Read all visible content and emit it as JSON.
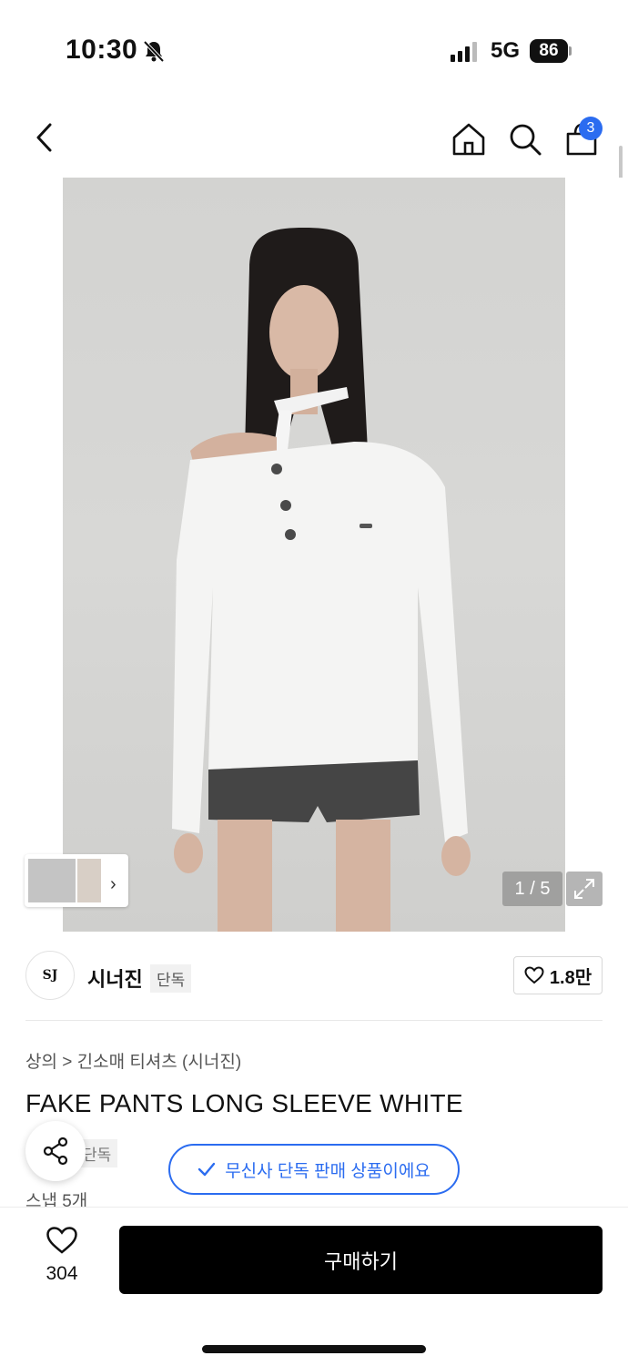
{
  "status_bar": {
    "time": "10:30",
    "network": "5G",
    "battery": "86",
    "icons": [
      "bell-slash-icon",
      "signal-icon"
    ]
  },
  "nav": {
    "cart_count": "3",
    "icons": [
      "back-icon",
      "home-icon",
      "search-icon",
      "cart-icon"
    ]
  },
  "gallery": {
    "counter": "1 / 5",
    "thumb_next": "›",
    "image_description_icon": "product-photo"
  },
  "brand": {
    "logo_text": "SJ",
    "name": "시너진",
    "tag": "단독",
    "likes": "1.8만"
  },
  "product": {
    "breadcrumb": "상의 > 긴소매 티셔츠 (시너진)",
    "title": "FAKE PANTS LONG SLEEVE WHITE",
    "exclusive_tag": "단독",
    "snap": "스냅 5개",
    "exclusive_notice": "무신사 단독 판매 상품이에요"
  },
  "bottom": {
    "wish_count": "304",
    "buy_label": "구매하기"
  },
  "colors": {
    "accent_blue": "#2b6cf0",
    "buy_button": "#000000"
  }
}
